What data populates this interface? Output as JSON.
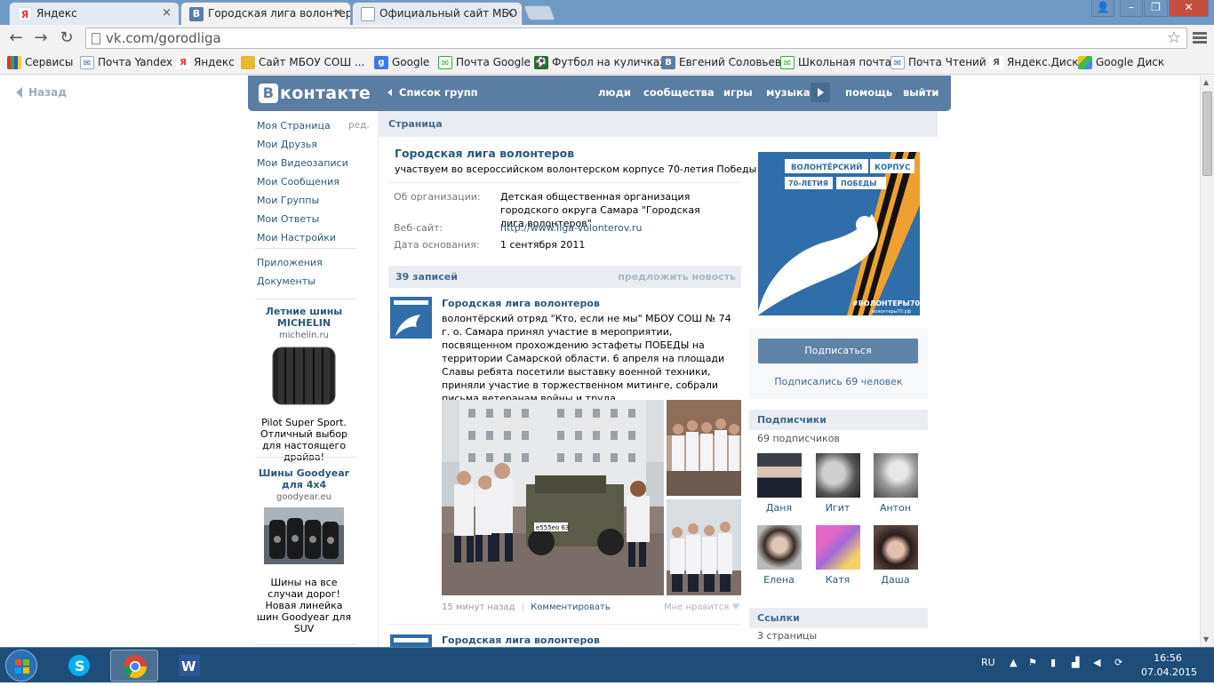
{
  "browser": {
    "tabs": [
      {
        "title": "Яндекс",
        "icon": "yandex-icon"
      },
      {
        "title": "Городская лига волонтер",
        "icon": "vk-icon"
      },
      {
        "title": "Официальный сайт МБО",
        "icon": "page-icon"
      }
    ],
    "url": "vk.com/gorodliga",
    "bookmarks": [
      {
        "label": "Сервисы",
        "icon": "apps-icon"
      },
      {
        "label": "Почта Yandex",
        "icon": "mail-icon"
      },
      {
        "label": "Яндекс",
        "icon": "yandex-icon"
      },
      {
        "label": "Сайт МБОУ СОШ ...",
        "icon": "folder-icon"
      },
      {
        "label": "Google",
        "icon": "google-icon"
      },
      {
        "label": "Почта Google",
        "icon": "gmail-icon"
      },
      {
        "label": "Футбол на куличках",
        "icon": "football-icon"
      },
      {
        "label": "Евгений Соловьев",
        "icon": "vk-icon"
      },
      {
        "label": "Школьная почта",
        "icon": "gmail-icon"
      },
      {
        "label": "Почта Чтений",
        "icon": "mail-icon"
      },
      {
        "label": "Яндекс.Диск",
        "icon": "yadisk-icon"
      },
      {
        "label": "Google Диск",
        "icon": "gdrive-icon"
      }
    ]
  },
  "page": {
    "back_label": "Назад",
    "logo_text": "контакте",
    "logo_letter": "В",
    "group_list": "Список групп",
    "nav": [
      "люди",
      "сообщества",
      "игры",
      "музыка",
      "помощь",
      "выйти"
    ],
    "sidebar": {
      "items": [
        "Моя Страница",
        "Мои Друзья",
        "Мои Видеозаписи",
        "Мои Сообщения",
        "Мои Группы",
        "Мои Ответы",
        "Мои Настройки"
      ],
      "edit": "ред.",
      "extra": [
        "Приложения",
        "Документы"
      ]
    },
    "ads": [
      {
        "title": "Летние шины MICHELIN",
        "domain": "michelin.ru",
        "desc": "Pilot Super Sport. Отличный выбор для настоящего драйва!"
      },
      {
        "title": "Шины Goodyear для 4x4",
        "domain": "goodyear.eu",
        "desc": "Шины на все случаи дорог! Новая линейка шин Goodyear для SUV"
      }
    ],
    "breadcrumb": "Страница",
    "group": {
      "name": "Городская лига волонтеров",
      "status": "участвуем во всероссийском волонтерском корпусе 70-летия Победы!",
      "info": [
        {
          "label": "Об организации:",
          "value": "Детская общественная организация городского округа Самара \"Городская лига волонтеров\""
        },
        {
          "label": "Веб-сайт:",
          "value": "http://www.liga-volonterov.ru"
        },
        {
          "label": "Дата основания:",
          "value": "1 сентября 2011"
        }
      ]
    },
    "wall": {
      "count": "39 записей",
      "suggest": "предложить новость",
      "posts": [
        {
          "author": "Городская лига волонтеров",
          "text": "волонтёрский отряд \"Кто, если не мы\" МБОУ СОШ № 74 г. о. Самара принял участие в мероприятии, посвященном прохождению эстафеты ПОБЕДЫ на территории Самарской области. 6 апреля на площади Славы ребята посетили выставку военной техники, приняли участие в торжественном митинге, собрали письма ветеранам войны и труда",
          "time": "15 минут назад",
          "comment": "Комментировать",
          "like": "Мне нравится",
          "plate": "е555ео 63"
        },
        {
          "author": "Городская лига волонтеров"
        }
      ]
    },
    "poster": {
      "line1": "ВОЛОНТЁРСКИЙ",
      "line1b": "КОРПУС",
      "line2a": "70-ЛЕТИЯ",
      "line2b": "ПОБЕДЫ",
      "hashtag": "#ВОЛОНТЕРЫ70",
      "site": "волонтеры70.рф"
    },
    "subscribe": {
      "button": "Подписаться",
      "count": "Подписались 69 человек"
    },
    "subscribers": {
      "title": "Подписчики",
      "count": "69 подписчиков",
      "members": [
        "Даня",
        "Игит",
        "Антон",
        "Елена",
        "Катя",
        "Даша"
      ]
    },
    "links": {
      "title": "Ссылки",
      "count": "3 страницы"
    }
  },
  "taskbar": {
    "lang": "RU",
    "time": "16:56",
    "date": "07.04.2015"
  },
  "colors": {
    "vk_blue": "#597da3",
    "link": "#2b587a",
    "taskbar": "#1f4d7a"
  }
}
